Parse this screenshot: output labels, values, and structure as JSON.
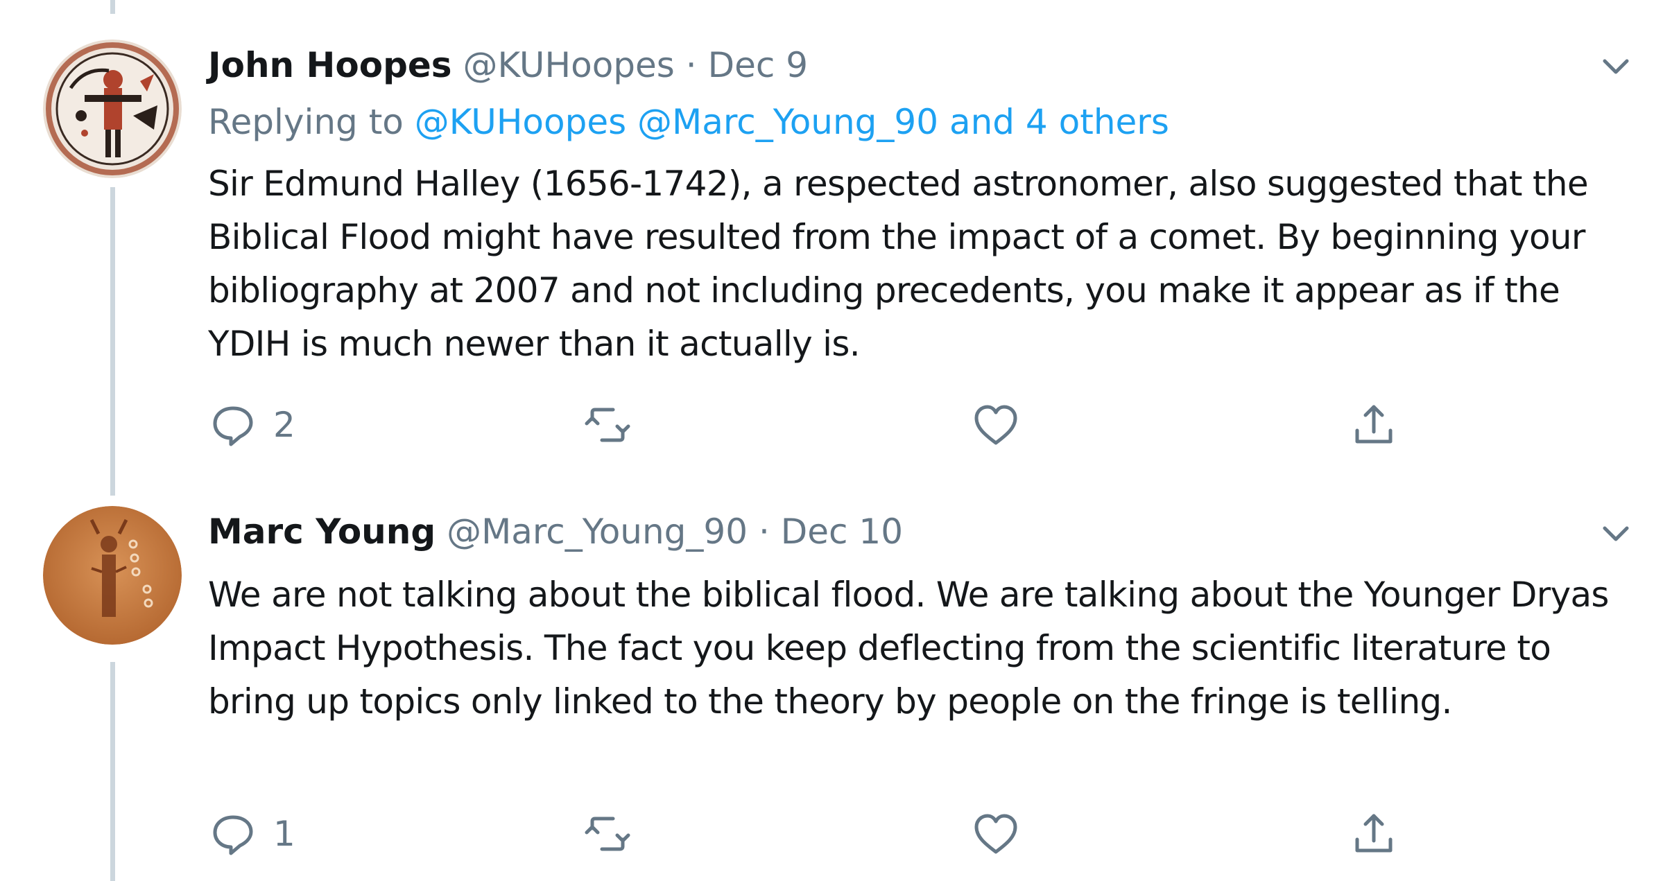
{
  "tweets": [
    {
      "name": "John Hoopes",
      "handle": "@KUHoopes",
      "separator": "·",
      "date": "Dec 9",
      "replying_prefix": "Replying to",
      "replying_handles": "@KUHoopes @Marc_Young_90",
      "replying_conj": "and",
      "replying_others": "4 others",
      "text": "Sir Edmund Halley (1656-1742), a respected astronomer, also suggested that the Biblical Flood might have resulted from the impact of a comet. By beginning your bibliography at 2007 and not including precedents, you make it appear as if the YDIH is much newer than it actually is.",
      "reply_count": "2",
      "avatar_icon": "pottery-figure-avatar"
    },
    {
      "name": "Marc Young",
      "handle": "@Marc_Young_90",
      "separator": "·",
      "date": "Dec 10",
      "text": "We are not talking about the biblical flood. We are talking about the Younger Dryas Impact Hypothesis. The fact you keep deflecting from the scientific literature to bring up topics only linked to the theory by people on the fringe is telling.",
      "reply_count": "1",
      "avatar_icon": "petroglyph-avatar"
    }
  ],
  "icons": {
    "reply": "reply-icon",
    "retweet": "retweet-icon",
    "like": "heart-icon",
    "share": "share-icon",
    "more": "chevron-down-icon"
  },
  "colors": {
    "text": "#14171a",
    "muted": "#657786",
    "link": "#1da1f2",
    "thread_line": "#ccd6dd"
  }
}
